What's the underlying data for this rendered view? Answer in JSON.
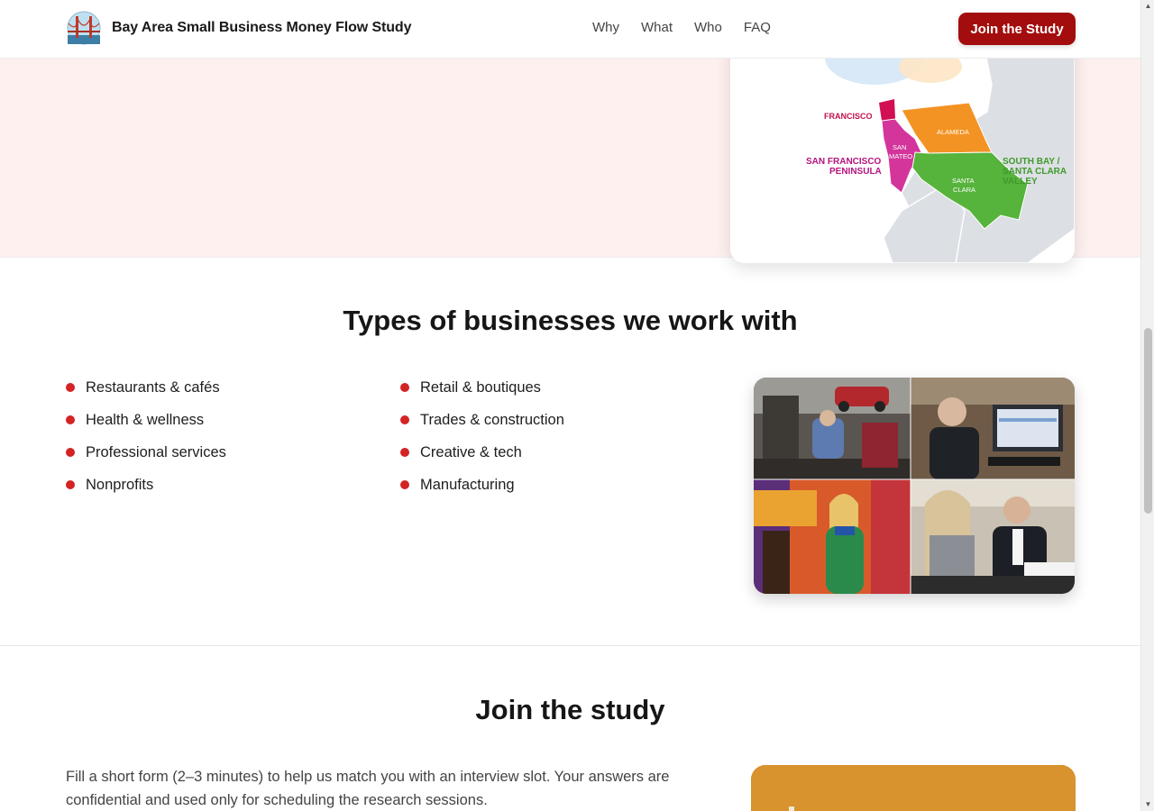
{
  "header": {
    "brand_name": "Bay Area Small Business Money Flow Study",
    "logo_icon": "golden-gate-bridge-icon",
    "nav": [
      "Why",
      "What",
      "Who",
      "FAQ"
    ],
    "cta_label": "Join the Study"
  },
  "map": {
    "labels": {
      "francisco": "FRANCISCO",
      "alameda": "ALAMEDA",
      "san": "SAN",
      "mateo": "MATEO",
      "sf_peninsula_1": "SAN FRANCISCO",
      "sf_peninsula_2": "PENINSULA",
      "santa": "SANTA",
      "clara": "CLARA",
      "south_bay_1": "SOUTH BAY /",
      "south_bay_2": "SANTA CLARA",
      "south_bay_3": "VALLEY"
    },
    "colors": {
      "san_francisco": "#d10f52",
      "alameda": "#f39323",
      "san_mateo": "#d3359b",
      "santa_clara": "#56b33c",
      "land": "#dcdfe3",
      "water": "#ffffff"
    }
  },
  "types": {
    "title": "Types of businesses we work with",
    "col1": [
      "Restaurants & cafés",
      "Health & wellness",
      "Professional services",
      "Nonprofits"
    ],
    "col2": [
      "Retail & boutiques",
      "Trades & construction",
      "Creative & tech",
      "Manufacturing"
    ],
    "bullet_color": "#d42323"
  },
  "join": {
    "title": "Join the study",
    "description": "Fill a short form (2–3 minutes) to help us match you with an interview slot. Your answers are confidential and used only for scheduling the research sessions."
  },
  "colors": {
    "accent": "#a30d0d",
    "hero_bg": "#fdf0ee",
    "form_card": "#d8922e"
  }
}
